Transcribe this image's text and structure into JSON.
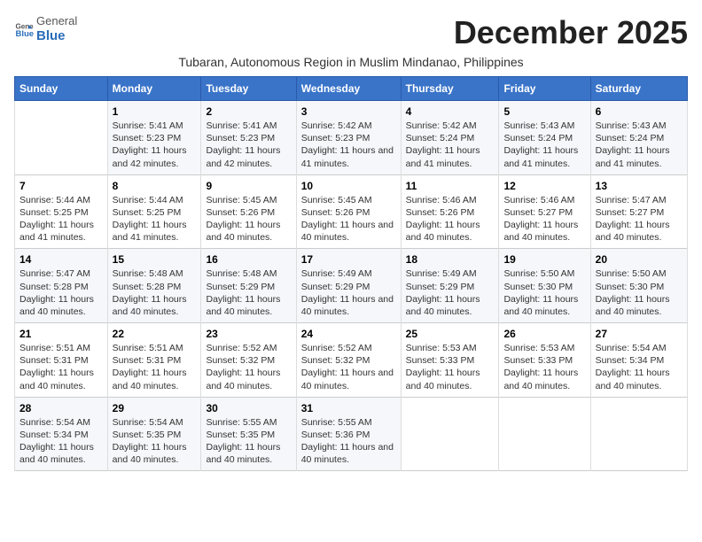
{
  "header": {
    "logo_general": "General",
    "logo_blue": "Blue",
    "month_year": "December 2025",
    "subtitle": "Tubaran, Autonomous Region in Muslim Mindanao, Philippines"
  },
  "calendar": {
    "days_of_week": [
      "Sunday",
      "Monday",
      "Tuesday",
      "Wednesday",
      "Thursday",
      "Friday",
      "Saturday"
    ],
    "weeks": [
      [
        {
          "num": "",
          "sunrise": "",
          "sunset": "",
          "daylight": ""
        },
        {
          "num": "1",
          "sunrise": "Sunrise: 5:41 AM",
          "sunset": "Sunset: 5:23 PM",
          "daylight": "Daylight: 11 hours and 42 minutes."
        },
        {
          "num": "2",
          "sunrise": "Sunrise: 5:41 AM",
          "sunset": "Sunset: 5:23 PM",
          "daylight": "Daylight: 11 hours and 42 minutes."
        },
        {
          "num": "3",
          "sunrise": "Sunrise: 5:42 AM",
          "sunset": "Sunset: 5:23 PM",
          "daylight": "Daylight: 11 hours and 41 minutes."
        },
        {
          "num": "4",
          "sunrise": "Sunrise: 5:42 AM",
          "sunset": "Sunset: 5:24 PM",
          "daylight": "Daylight: 11 hours and 41 minutes."
        },
        {
          "num": "5",
          "sunrise": "Sunrise: 5:43 AM",
          "sunset": "Sunset: 5:24 PM",
          "daylight": "Daylight: 11 hours and 41 minutes."
        },
        {
          "num": "6",
          "sunrise": "Sunrise: 5:43 AM",
          "sunset": "Sunset: 5:24 PM",
          "daylight": "Daylight: 11 hours and 41 minutes."
        }
      ],
      [
        {
          "num": "7",
          "sunrise": "Sunrise: 5:44 AM",
          "sunset": "Sunset: 5:25 PM",
          "daylight": "Daylight: 11 hours and 41 minutes."
        },
        {
          "num": "8",
          "sunrise": "Sunrise: 5:44 AM",
          "sunset": "Sunset: 5:25 PM",
          "daylight": "Daylight: 11 hours and 41 minutes."
        },
        {
          "num": "9",
          "sunrise": "Sunrise: 5:45 AM",
          "sunset": "Sunset: 5:26 PM",
          "daylight": "Daylight: 11 hours and 40 minutes."
        },
        {
          "num": "10",
          "sunrise": "Sunrise: 5:45 AM",
          "sunset": "Sunset: 5:26 PM",
          "daylight": "Daylight: 11 hours and 40 minutes."
        },
        {
          "num": "11",
          "sunrise": "Sunrise: 5:46 AM",
          "sunset": "Sunset: 5:26 PM",
          "daylight": "Daylight: 11 hours and 40 minutes."
        },
        {
          "num": "12",
          "sunrise": "Sunrise: 5:46 AM",
          "sunset": "Sunset: 5:27 PM",
          "daylight": "Daylight: 11 hours and 40 minutes."
        },
        {
          "num": "13",
          "sunrise": "Sunrise: 5:47 AM",
          "sunset": "Sunset: 5:27 PM",
          "daylight": "Daylight: 11 hours and 40 minutes."
        }
      ],
      [
        {
          "num": "14",
          "sunrise": "Sunrise: 5:47 AM",
          "sunset": "Sunset: 5:28 PM",
          "daylight": "Daylight: 11 hours and 40 minutes."
        },
        {
          "num": "15",
          "sunrise": "Sunrise: 5:48 AM",
          "sunset": "Sunset: 5:28 PM",
          "daylight": "Daylight: 11 hours and 40 minutes."
        },
        {
          "num": "16",
          "sunrise": "Sunrise: 5:48 AM",
          "sunset": "Sunset: 5:29 PM",
          "daylight": "Daylight: 11 hours and 40 minutes."
        },
        {
          "num": "17",
          "sunrise": "Sunrise: 5:49 AM",
          "sunset": "Sunset: 5:29 PM",
          "daylight": "Daylight: 11 hours and 40 minutes."
        },
        {
          "num": "18",
          "sunrise": "Sunrise: 5:49 AM",
          "sunset": "Sunset: 5:29 PM",
          "daylight": "Daylight: 11 hours and 40 minutes."
        },
        {
          "num": "19",
          "sunrise": "Sunrise: 5:50 AM",
          "sunset": "Sunset: 5:30 PM",
          "daylight": "Daylight: 11 hours and 40 minutes."
        },
        {
          "num": "20",
          "sunrise": "Sunrise: 5:50 AM",
          "sunset": "Sunset: 5:30 PM",
          "daylight": "Daylight: 11 hours and 40 minutes."
        }
      ],
      [
        {
          "num": "21",
          "sunrise": "Sunrise: 5:51 AM",
          "sunset": "Sunset: 5:31 PM",
          "daylight": "Daylight: 11 hours and 40 minutes."
        },
        {
          "num": "22",
          "sunrise": "Sunrise: 5:51 AM",
          "sunset": "Sunset: 5:31 PM",
          "daylight": "Daylight: 11 hours and 40 minutes."
        },
        {
          "num": "23",
          "sunrise": "Sunrise: 5:52 AM",
          "sunset": "Sunset: 5:32 PM",
          "daylight": "Daylight: 11 hours and 40 minutes."
        },
        {
          "num": "24",
          "sunrise": "Sunrise: 5:52 AM",
          "sunset": "Sunset: 5:32 PM",
          "daylight": "Daylight: 11 hours and 40 minutes."
        },
        {
          "num": "25",
          "sunrise": "Sunrise: 5:53 AM",
          "sunset": "Sunset: 5:33 PM",
          "daylight": "Daylight: 11 hours and 40 minutes."
        },
        {
          "num": "26",
          "sunrise": "Sunrise: 5:53 AM",
          "sunset": "Sunset: 5:33 PM",
          "daylight": "Daylight: 11 hours and 40 minutes."
        },
        {
          "num": "27",
          "sunrise": "Sunrise: 5:54 AM",
          "sunset": "Sunset: 5:34 PM",
          "daylight": "Daylight: 11 hours and 40 minutes."
        }
      ],
      [
        {
          "num": "28",
          "sunrise": "Sunrise: 5:54 AM",
          "sunset": "Sunset: 5:34 PM",
          "daylight": "Daylight: 11 hours and 40 minutes."
        },
        {
          "num": "29",
          "sunrise": "Sunrise: 5:54 AM",
          "sunset": "Sunset: 5:35 PM",
          "daylight": "Daylight: 11 hours and 40 minutes."
        },
        {
          "num": "30",
          "sunrise": "Sunrise: 5:55 AM",
          "sunset": "Sunset: 5:35 PM",
          "daylight": "Daylight: 11 hours and 40 minutes."
        },
        {
          "num": "31",
          "sunrise": "Sunrise: 5:55 AM",
          "sunset": "Sunset: 5:36 PM",
          "daylight": "Daylight: 11 hours and 40 minutes."
        },
        {
          "num": "",
          "sunrise": "",
          "sunset": "",
          "daylight": ""
        },
        {
          "num": "",
          "sunrise": "",
          "sunset": "",
          "daylight": ""
        },
        {
          "num": "",
          "sunrise": "",
          "sunset": "",
          "daylight": ""
        }
      ]
    ]
  }
}
